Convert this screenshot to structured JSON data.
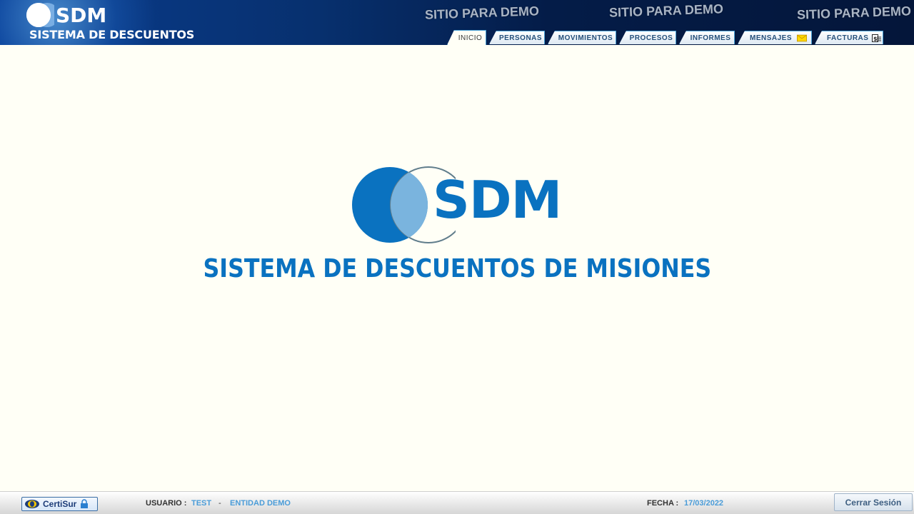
{
  "brand": {
    "short": "SDM",
    "subtitle": "SISTEMA DE DESCUENTOS"
  },
  "watermarks": [
    "SITIO PARA DEMO",
    "SITIO PARA DEMO",
    "SITIO PARA DEMO"
  ],
  "tabs": [
    {
      "label": "INICIO",
      "active": true
    },
    {
      "label": "PERSONAS",
      "active": false
    },
    {
      "label": "MOVIMIENTOS",
      "active": false
    },
    {
      "label": "PROCESOS",
      "active": false
    },
    {
      "label": "INFORMES",
      "active": false
    },
    {
      "label": "MENSAJES",
      "active": false,
      "icon": "mail-icon"
    },
    {
      "label": "FACTURAS",
      "active": false,
      "icon": "invoice-icon"
    }
  ],
  "main": {
    "logo_text": "SDM",
    "title": "SISTEMA DE DESCUENTOS DE MISIONES"
  },
  "footer": {
    "certisur_label": "CertiSur",
    "usuario_label": "USUARIO :",
    "usuario_value": "TEST",
    "separator": "-",
    "entidad_value": "ENTIDAD DEMO",
    "fecha_label": "FECHA :",
    "fecha_value": "17/03/2022",
    "logout_label": "Cerrar Sesión"
  },
  "colors": {
    "accent": "#0a72c0",
    "header_dark": "#04163a",
    "tab_border": "#4aa3d8",
    "footer_value": "#4a9cd8"
  }
}
